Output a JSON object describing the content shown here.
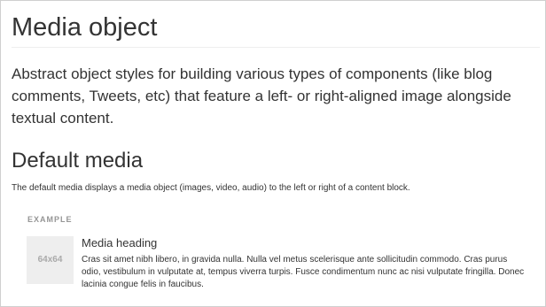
{
  "page": {
    "title": "Media object",
    "lead": "Abstract object styles for building various types of components (like blog comments, Tweets, etc) that feature a left- or right-aligned image alongside textual content."
  },
  "section": {
    "title": "Default media",
    "description": "The default media displays a media object (images, video, audio) to the left or right of a content block."
  },
  "example": {
    "label": "EXAMPLE",
    "media": {
      "placeholder": "64x64",
      "heading": "Media heading",
      "body": "Cras sit amet nibh libero, in gravida nulla. Nulla vel metus scelerisque ante sollicitudin commodo. Cras purus odio, vestibulum in vulputate at, tempus viverra turpis. Fusce condimentum nunc ac nisi vulputate fringilla. Donec lacinia congue felis in faucibus."
    }
  }
}
